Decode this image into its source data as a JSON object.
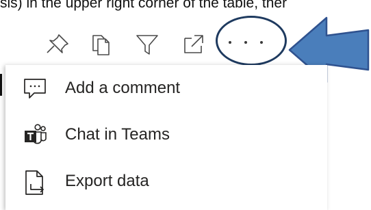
{
  "caption": {
    "text": "sis) in the upper right corner of the table, ther"
  },
  "toolbar": {
    "icons": [
      "pin-icon",
      "copy-icon",
      "filter-icon",
      "focus-mode-icon",
      "more-options-icon"
    ]
  },
  "menu": {
    "items": [
      {
        "label": "Add a comment",
        "icon": "comment-icon"
      },
      {
        "label": "Chat in Teams",
        "icon": "teams-icon"
      },
      {
        "label": "Export data",
        "icon": "export-data-icon"
      }
    ]
  },
  "annotation": {
    "circle_color": "#1e3a5f",
    "arrow_fill": "#4a7ebb",
    "arrow_stroke": "#2f528f"
  }
}
